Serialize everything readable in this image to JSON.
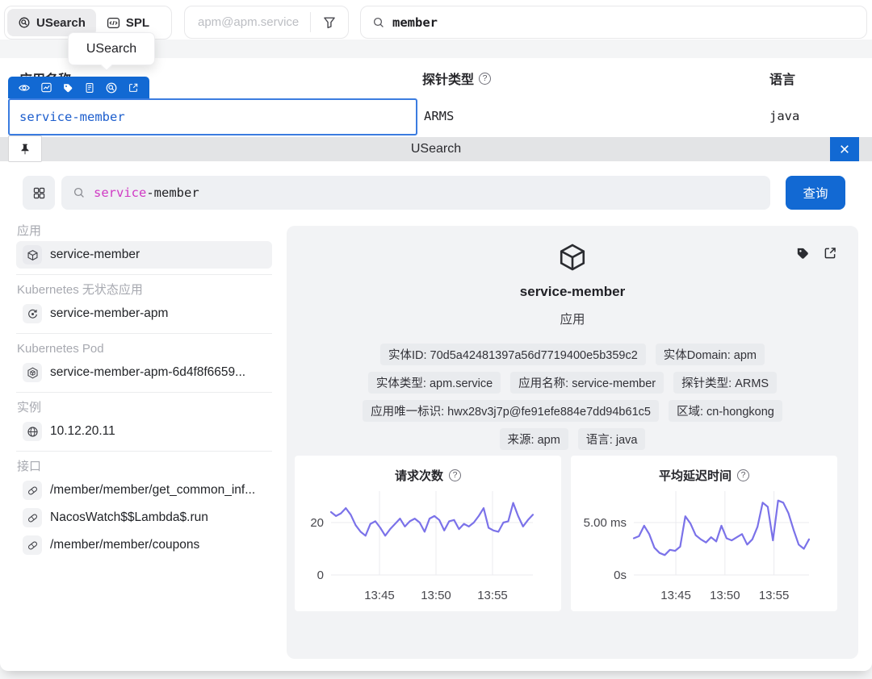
{
  "colors": {
    "accent_blue": "#1269d3",
    "line_purple": "#7b72e9",
    "query_magenta": "#d03ac4",
    "editor_text_blue": "#1d5ecd"
  },
  "topbar": {
    "tab_usearch": "USearch",
    "tab_spl": "SPL",
    "scope_placeholder": "apm@apm.service",
    "search_value": "member",
    "tooltip": "USearch"
  },
  "table": {
    "headers": {
      "app_name": "应用名称",
      "probe_type": "探针类型",
      "language": "语言"
    },
    "cell_editor_value": "service-member",
    "row": {
      "probe_type": "ARMS",
      "language": "java"
    }
  },
  "panel": {
    "title": "USearch",
    "search": {
      "highlight": "service",
      "rest": "-member"
    },
    "query_button": "查询",
    "sidebar": {
      "groups": [
        {
          "label": "应用",
          "items": [
            {
              "text": "service-member",
              "icon": "cube",
              "selected": true
            }
          ]
        },
        {
          "label": "Kubernetes 无状态应用",
          "items": [
            {
              "text": "service-member-apm",
              "icon": "deployment",
              "selected": false
            }
          ]
        },
        {
          "label": "Kubernetes Pod",
          "items": [
            {
              "text": "service-member-apm-6d4f8f6659...",
              "icon": "pod",
              "selected": false
            }
          ]
        },
        {
          "label": "实例",
          "items": [
            {
              "text": "10.12.20.11",
              "icon": "globe",
              "selected": false
            }
          ]
        },
        {
          "label": "接口",
          "items": [
            {
              "text": "/member/member/get_common_inf...",
              "icon": "api",
              "selected": false
            },
            {
              "text": "NacosWatch$$Lambda$.run",
              "icon": "api",
              "selected": false
            },
            {
              "text": "/member/member/coupons",
              "icon": "api",
              "selected": false
            }
          ]
        }
      ]
    },
    "detail": {
      "title": "service-member",
      "subtitle": "应用",
      "tags": [
        "实体ID: 70d5a42481397a56d7719400e5b359c2",
        "实体Domain: apm",
        "实体类型: apm.service",
        "应用名称: service-member",
        "探针类型: ARMS",
        "应用唯一标识: hwx28v3j7p@fe91efe884e7dd94b61c5",
        "区域: cn-hongkong",
        "来源: apm",
        "语言: java"
      ]
    }
  },
  "chart_data": [
    {
      "type": "line",
      "title": "请求次数",
      "x_tick_labels": [
        "13:45",
        "13:50",
        "13:55"
      ],
      "x_tick_fracs": [
        0.24,
        0.52,
        0.8
      ],
      "y_ticks": [
        {
          "value": 20,
          "label": "20"
        },
        {
          "value": 0,
          "label": "0"
        }
      ],
      "ylim": [
        0,
        32
      ],
      "label_gutter": 45,
      "values": [
        24,
        22.5,
        23.5,
        25.5,
        23,
        19,
        16.5,
        15,
        19.5,
        20.5,
        18,
        15,
        17.5,
        19.5,
        21.5,
        18.5,
        20.5,
        21.5,
        20,
        16.5,
        21.5,
        22.5,
        21,
        17,
        20.5,
        21,
        17.5,
        19.5,
        18.5,
        20,
        22.5,
        25.5,
        18,
        17,
        16.5,
        20,
        20.5,
        27.5,
        22.5,
        18.5,
        21,
        23
      ]
    },
    {
      "type": "line",
      "title": "平均延迟时间",
      "x_tick_labels": [
        "13:45",
        "13:50",
        "13:55"
      ],
      "x_tick_fracs": [
        0.24,
        0.52,
        0.8
      ],
      "y_ticks": [
        {
          "value": 5,
          "label": "5.00 ms"
        },
        {
          "value": 0,
          "label": "0s"
        }
      ],
      "ylim": [
        0,
        8
      ],
      "label_gutter": 78,
      "values": [
        3.5,
        3.7,
        4.7,
        3.9,
        2.6,
        2.1,
        1.9,
        2.4,
        2.3,
        2.7,
        5.6,
        4.9,
        3.8,
        3.4,
        3.1,
        3.6,
        3.2,
        4.7,
        3.5,
        3.3,
        3.6,
        3.9,
        2.9,
        3.4,
        4.6,
        6.9,
        6.5,
        3.3,
        7.1,
        6.9,
        5.9,
        4.3,
        2.9,
        2.5,
        3.4
      ]
    }
  ]
}
